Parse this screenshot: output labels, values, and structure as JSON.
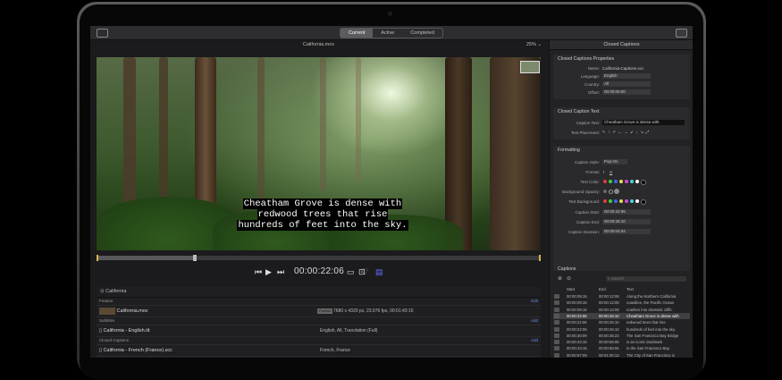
{
  "toolbar": {
    "tabs": [
      "Current",
      "Active",
      "Completed"
    ],
    "active_tab": "Current"
  },
  "viewer": {
    "filename": "California.mov",
    "zoom": "25%",
    "caption_lines": [
      "Cheatham Grove is dense with",
      "redwood trees that rise",
      "hundreds of feet into the sky."
    ],
    "timecode": "00:00:22:06"
  },
  "library": {
    "title": "California",
    "sections": [
      {
        "name": "Feature",
        "action": "Edit",
        "item": "California.mov",
        "badge": "ProRes",
        "detail": "7680 x 4320 px, 23.976 fps, 00:01:43:15"
      },
      {
        "name": "Subtitles",
        "action": "Add",
        "item": "California - English.itt",
        "detail": "English, All, Translation (Full)"
      },
      {
        "name": "Closed Captions",
        "action": "Add",
        "item": "California - French (France).scc",
        "detail": "French, France"
      }
    ]
  },
  "inspector": {
    "title": "Closed Captions",
    "properties": {
      "title": "Closed Captions Properties",
      "name_label": "Name:",
      "name": "California-Captions.scc",
      "language_label": "Language:",
      "language": "English",
      "country_label": "Country:",
      "country": "All",
      "offset_label": "Offset:",
      "offset": "00:00:00:00"
    },
    "caption_text": {
      "title": "Closed Caption Text",
      "text_label": "Caption Text:",
      "text": "Cheatham Grove is dense with",
      "placement_label": "Text Placement:"
    },
    "formatting": {
      "title": "Formatting",
      "style_label": "Caption Style:",
      "style": "Pop-On",
      "format_label": "Format:",
      "format_italic": "I",
      "format_underline": "U",
      "text_color_label": "Text Color:",
      "bg_opacity_label": "Background Opacity:",
      "text_bg_label": "Text Background:",
      "start_label": "Caption Start:",
      "start": "00:00:22:06",
      "end_label": "Caption End:",
      "end": "00:00:26:10",
      "duration_label": "Caption Duration:",
      "duration": "00:00:04:04",
      "colors": [
        "#e23b3b",
        "#39d04a",
        "#3a6cf0",
        "#e8e04a",
        "#d04ad8",
        "#49d6e0",
        "#ffffff",
        "#000000"
      ]
    },
    "captions": {
      "title": "Captions",
      "search_placeholder": "Search",
      "columns": [
        "Start",
        "End",
        "Text"
      ],
      "rows": [
        {
          "start": "00:00:09:15",
          "end": "00:00:12:08",
          "text": "Along the Northern California"
        },
        {
          "start": "00:00:09:15",
          "end": "00:00:12:08",
          "text": "coastline, the Pacific Ocean"
        },
        {
          "start": "00:00:09:15",
          "end": "00:00:12:08",
          "text": "crashes into dramatic cliffs."
        },
        {
          "start": "00:00:22:06",
          "end": "00:00:26:10",
          "text": "Cheatham Grove is dense with"
        },
        {
          "start": "00:00:22:06",
          "end": "00:00:26:10",
          "text": "redwood trees that rise"
        },
        {
          "start": "00:00:22:06",
          "end": "00:00:26:10",
          "text": "hundreds of feet into the sky."
        },
        {
          "start": "00:00:30:09",
          "end": "00:00:35:23",
          "text": "The San Francisco Bay Bridge"
        },
        {
          "start": "00:00:43:15",
          "end": "00:00:56:06",
          "text": "is an iconic landmark"
        },
        {
          "start": "00:00:43:15",
          "end": "00:00:58:06",
          "text": "in the San Francisco Bay."
        },
        {
          "start": "00:00:57:09",
          "end": "00:01:00:13",
          "text": "The City of San Francisco is"
        },
        {
          "start": "00:00:57:09",
          "end": "00:01:00:13",
          "text": "majestic,"
        },
        {
          "start": "00:01:03:14",
          "end": "00:01:07:06",
          "text": "where the Bay Bridge,"
        },
        {
          "start": "00:01:03:14",
          "end": "00:01:07:06",
          "text": "Coit Tower,"
        }
      ],
      "selected_index": 3
    }
  }
}
